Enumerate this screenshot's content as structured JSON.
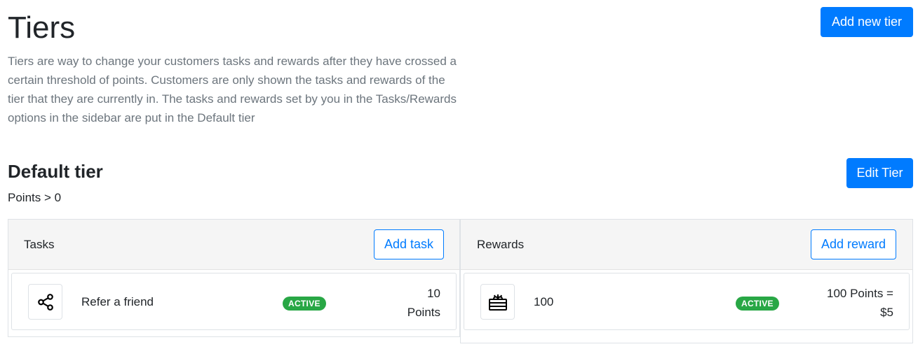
{
  "header": {
    "title": "Tiers",
    "description": "Tiers are way to change your customers tasks and rewards after they have crossed a certain threshold of points. Customers are only shown the tasks and rewards of the tier that they are currently in. The tasks and rewards set by you in the Tasks/Rewards options in the sidebar are put in the Default tier",
    "add_tier_label": "Add new tier"
  },
  "tier": {
    "name": "Default tier",
    "condition": "Points > 0",
    "edit_label": "Edit Tier",
    "tasks": {
      "header": "Tasks",
      "add_label": "Add task",
      "items": [
        {
          "icon": "share-icon",
          "name": "Refer a friend",
          "status": "ACTIVE",
          "value_line1": "10",
          "value_line2": "Points"
        }
      ]
    },
    "rewards": {
      "header": "Rewards",
      "add_label": "Add reward",
      "items": [
        {
          "icon": "gift-icon",
          "name": "100",
          "status": "ACTIVE",
          "value_line1": "100 Points =",
          "value_line2": "$5"
        }
      ]
    }
  },
  "colors": {
    "primary": "#007bff",
    "success": "#28a745",
    "muted": "#6c757d"
  }
}
